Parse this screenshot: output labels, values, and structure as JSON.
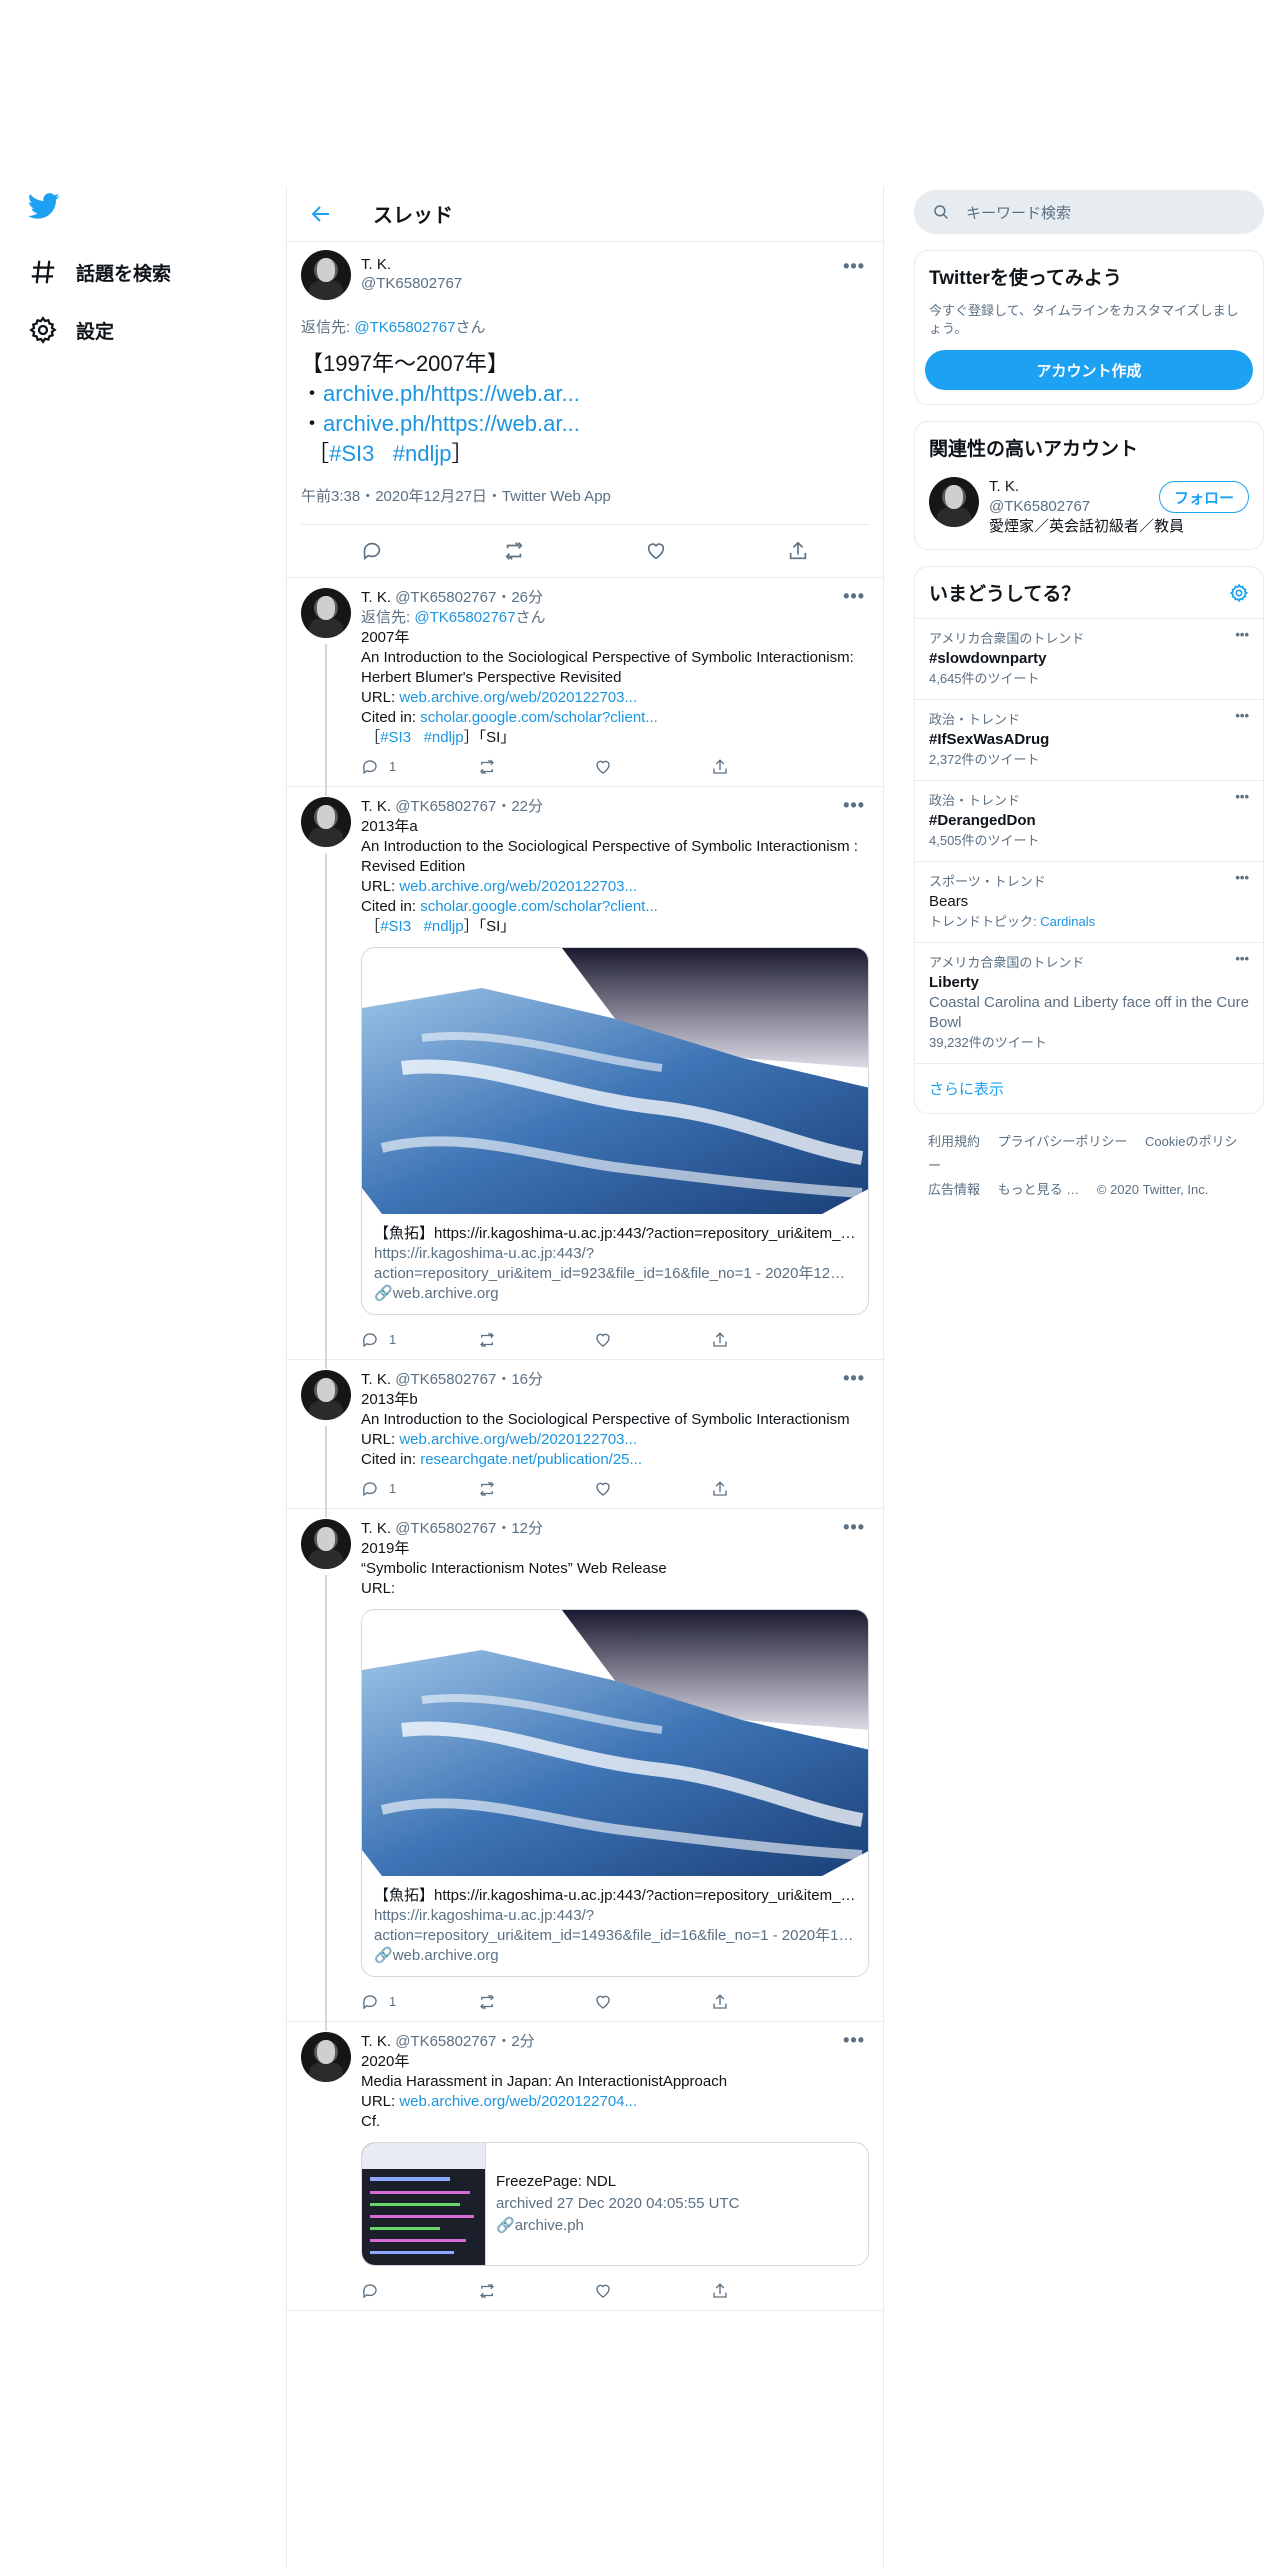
{
  "nav": {
    "items": [
      {
        "label": "話題を検索",
        "icon": "hashtag-icon"
      },
      {
        "label": "設定",
        "icon": "gear-icon"
      }
    ]
  },
  "header": {
    "title": "スレッド"
  },
  "focus_tweet": {
    "name": "T. K.",
    "handle": "@TK65802767",
    "reply_prefix": "返信先: ",
    "reply_handle": "@TK65802767",
    "reply_suffix": "さん",
    "line1": "【1997年～2007年】",
    "bullet": "・",
    "link1": "archive.ph/https://web.ar...",
    "link2": "archive.ph/https://web.ar...",
    "tag_open": "［",
    "tag1": "#SI3",
    "tag2": "#ndljp",
    "tag_close": "］",
    "meta": "午前3:38・2020年12月27日・Twitter Web App"
  },
  "tweets": [
    {
      "name": "T. K.",
      "meta": "@TK65802767・26分",
      "reply_prefix": "返信先: ",
      "reply_handle": "@TK65802767",
      "reply_suffix": "さん",
      "year": "2007年",
      "title": "An Introduction to the Sociological Perspective of Symbolic Interactionism: Herbert Blumer's Perspective Revisited",
      "url_label": "URL: ",
      "url": "web.archive.org/web/2020122703...",
      "cited_label": "Cited in: ",
      "cited": "scholar.google.com/scholar?client...",
      "tag_open": "［",
      "tag1": "#SI3",
      "tag2": "#ndljp",
      "tag_close": "］「SI」",
      "reply_count": "1"
    },
    {
      "name": "T. K.",
      "meta": "@TK65802767・22分",
      "year": "2013年a",
      "title": "An Introduction to the Sociological Perspective of Symbolic Interactionism : Revised Edition",
      "url_label": "URL: ",
      "url": "web.archive.org/web/2020122703...",
      "cited_label": "Cited in: ",
      "cited": "scholar.google.com/scholar?client...",
      "tag_open": "［",
      "tag1": "#SI3",
      "tag2": "#ndljp",
      "tag_close": "］「SI」",
      "card": {
        "title": "【魚拓】https://ir.kagoshima-u.ac.jp:443/?action=repository_uri&item_id...",
        "desc1": "https://ir.kagoshima-u.ac.jp:443/?",
        "desc2": "action=repository_uri&item_id=923&file_id=16&file_no=1 - 2020年12月2...",
        "domain": "web.archive.org"
      },
      "reply_count": "1"
    },
    {
      "name": "T. K.",
      "meta": "@TK65802767・16分",
      "year": "2013年b",
      "title": "An Introduction to the Sociological Perspective of Symbolic Interactionism",
      "url_label": "URL: ",
      "url": "web.archive.org/web/2020122703...",
      "cited_label": "Cited in: ",
      "cited": "researchgate.net/publication/25...",
      "reply_count": "1"
    },
    {
      "name": "T. K.",
      "meta": "@TK65802767・12分",
      "year": "2019年",
      "title": "“Symbolic Interactionism Notes” Web Release",
      "url_label": "URL:",
      "card": {
        "title": "【魚拓】https://ir.kagoshima-u.ac.jp:443/?action=repository_uri&item_id...",
        "desc1": "https://ir.kagoshima-u.ac.jp:443/?",
        "desc2": "action=repository_uri&item_id=14936&file_id=16&file_no=1 - 2020年12...",
        "domain": "web.archive.org"
      },
      "reply_count": "1"
    },
    {
      "name": "T. K.",
      "meta": "@TK65802767・2分",
      "year": "2020年",
      "title": "Media Harassment in Japan: An InteractionistApproach",
      "url_label": "URL: ",
      "url": "web.archive.org/web/2020122704...",
      "cf": "Cf.",
      "card": {
        "title": "FreezePage: NDL",
        "desc": "archived 27 Dec 2020 04:05:55 UTC",
        "domain": "archive.ph"
      }
    }
  ],
  "right": {
    "search_placeholder": "キーワード検索",
    "signup": {
      "title": "Twitterを使ってみよう",
      "desc": "今すぐ登録して、タイムラインをカスタマイズしましょう。",
      "button": "アカウント作成"
    },
    "relevant": {
      "title": "関連性の高いアカウント",
      "name": "T. K.",
      "handle": "@TK65802767",
      "bio": "愛煙家／英会話初級者／教員",
      "follow": "フォロー"
    },
    "trends": {
      "title": "いまどうしてる？",
      "items": [
        {
          "context": "アメリカ合衆国のトレンド",
          "topic": "#slowdownparty",
          "count": "4,645件のツイート"
        },
        {
          "context": "政治・トレンド",
          "topic": "#IfSexWasADrug",
          "count": "2,372件のツイート"
        },
        {
          "context": "政治・トレンド",
          "topic": "#DerangedDon",
          "count": "4,505件のツイート"
        },
        {
          "context": "スポーツ・トレンド",
          "topic": "Bears",
          "related_label": "トレンドトピック: ",
          "related": "Cardinals"
        },
        {
          "context": "アメリカ合衆国のトレンド",
          "topic": "Liberty",
          "desc": "Coastal Carolina and Liberty face off in the Cure Bowl",
          "count": "39,232件のツイート"
        }
      ],
      "show_more": "さらに表示"
    },
    "footer": {
      "links": [
        "利用規約",
        "プライバシーポリシー",
        "Cookieのポリシー",
        "広告情報",
        "もっと見る …",
        "© 2020 Twitter, Inc."
      ]
    }
  },
  "colors": {
    "accent": "#1da1f2",
    "link": "#1b95e0",
    "muted": "#5b7083",
    "border": "#e6ecf0"
  }
}
